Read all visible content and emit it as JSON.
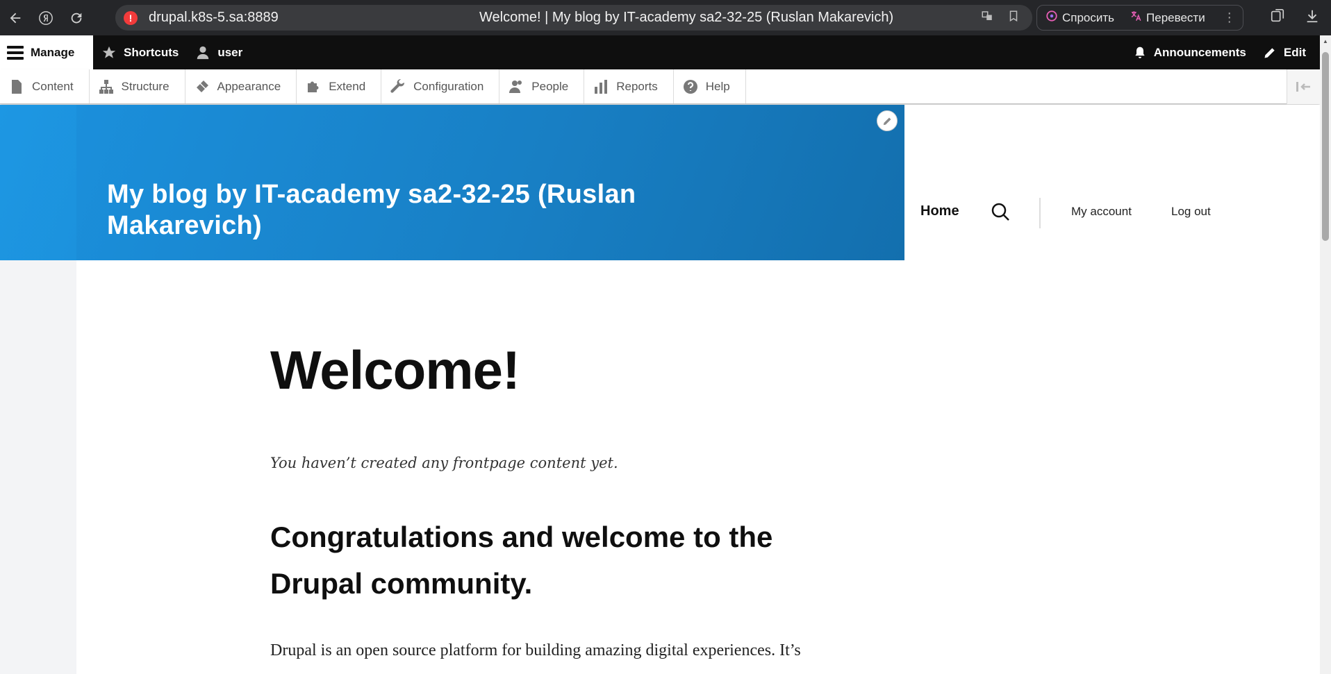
{
  "browser": {
    "url": "drupal.k8s-5.sa:8889",
    "tab_title": "Welcome! | My blog by IT-academy sa2-32-25 (Ruslan Makarevich)",
    "ask_label": "Спросить",
    "translate_label": "Перевести",
    "alert_glyph": "!"
  },
  "toolbar": {
    "manage": "Manage",
    "shortcuts": "Shortcuts",
    "user": "user",
    "announcements": "Announcements",
    "edit": "Edit"
  },
  "tray": {
    "items": [
      {
        "label": "Content",
        "icon": "file-icon"
      },
      {
        "label": "Structure",
        "icon": "sitemap-icon"
      },
      {
        "label": "Appearance",
        "icon": "paintbrush-icon"
      },
      {
        "label": "Extend",
        "icon": "puzzle-icon"
      },
      {
        "label": "Configuration",
        "icon": "wrench-icon"
      },
      {
        "label": "People",
        "icon": "people-icon"
      },
      {
        "label": "Reports",
        "icon": "bar-chart-icon"
      },
      {
        "label": "Help",
        "icon": "help-icon"
      }
    ]
  },
  "site": {
    "name": "My blog by IT-academy sa2-32-25 (Ruslan Makarevich)",
    "nav": {
      "home": "Home",
      "my_account": "My account",
      "log_out": "Log out"
    }
  },
  "main": {
    "title": "Welcome!",
    "empty_message": "You haven’t created any frontpage content yet.",
    "heading": "Congratulations and welcome to the Drupal community.",
    "body": "Drupal is an open source platform for building amazing digital experiences. It’s"
  },
  "colors": {
    "hero_blue": "#1b87cf",
    "toolbar_black": "#0f0f0f",
    "chrome_dark": "#252629"
  }
}
